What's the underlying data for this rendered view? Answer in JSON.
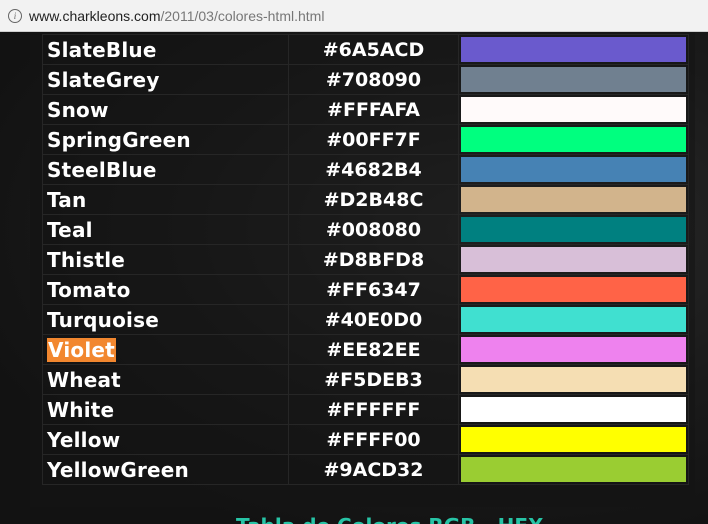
{
  "browser": {
    "url_host": "www.charkleons.com",
    "url_path": "/2011/03/colores-html.html"
  },
  "colors": [
    {
      "name": "SlateBlue",
      "hex": "#6A5ACD"
    },
    {
      "name": "SlateGrey",
      "hex": "#708090"
    },
    {
      "name": "Snow",
      "hex": "#FFFAFA"
    },
    {
      "name": "SpringGreen",
      "hex": "#00FF7F"
    },
    {
      "name": "SteelBlue",
      "hex": "#4682B4"
    },
    {
      "name": "Tan",
      "hex": "#D2B48C"
    },
    {
      "name": "Teal",
      "hex": "#008080"
    },
    {
      "name": "Thistle",
      "hex": "#D8BFD8"
    },
    {
      "name": "Tomato",
      "hex": "#FF6347"
    },
    {
      "name": "Turquoise",
      "hex": "#40E0D0"
    },
    {
      "name": "Violet",
      "hex": "#EE82EE",
      "highlighted": true
    },
    {
      "name": "Wheat",
      "hex": "#F5DEB3"
    },
    {
      "name": "White",
      "hex": "#FFFFFF"
    },
    {
      "name": "Yellow",
      "hex": "#FFFF00"
    },
    {
      "name": "YellowGreen",
      "hex": "#9ACD32"
    }
  ],
  "highlight_color": "#F2872F",
  "footer": {
    "partial_title": "Tabla de Colores RGB - HEX"
  },
  "theme": {
    "accent": "#27C4A6"
  }
}
